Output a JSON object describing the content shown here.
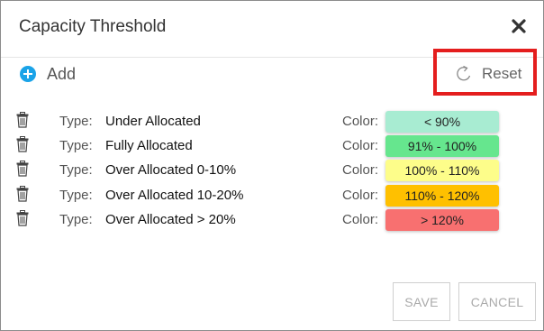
{
  "dialog": {
    "title": "Capacity Threshold"
  },
  "toolbar": {
    "add_label": "Add",
    "reset_label": "Reset"
  },
  "labels": {
    "type": "Type:",
    "color": "Color:"
  },
  "rows": [
    {
      "type": "Under Allocated",
      "range": "< 90%",
      "color": "#a8ecd2"
    },
    {
      "type": "Fully Allocated",
      "range": "91% - 100%",
      "color": "#66e68e"
    },
    {
      "type": "Over Allocated 0-10%",
      "range": "100% - 110%",
      "color": "#fdfd8a"
    },
    {
      "type": "Over Allocated 10-20%",
      "range": "110% - 120%",
      "color": "#ffc000"
    },
    {
      "type": "Over Allocated > 20%",
      "range": "> 120%",
      "color": "#f87070"
    }
  ],
  "footer": {
    "save_label": "SAVE",
    "cancel_label": "CANCEL"
  },
  "theme": {
    "highlight": "#e41e1e",
    "accent": "#1aa3e8"
  },
  "icons": [
    "close-icon",
    "add-icon",
    "reset-icon",
    "trash-icon"
  ]
}
